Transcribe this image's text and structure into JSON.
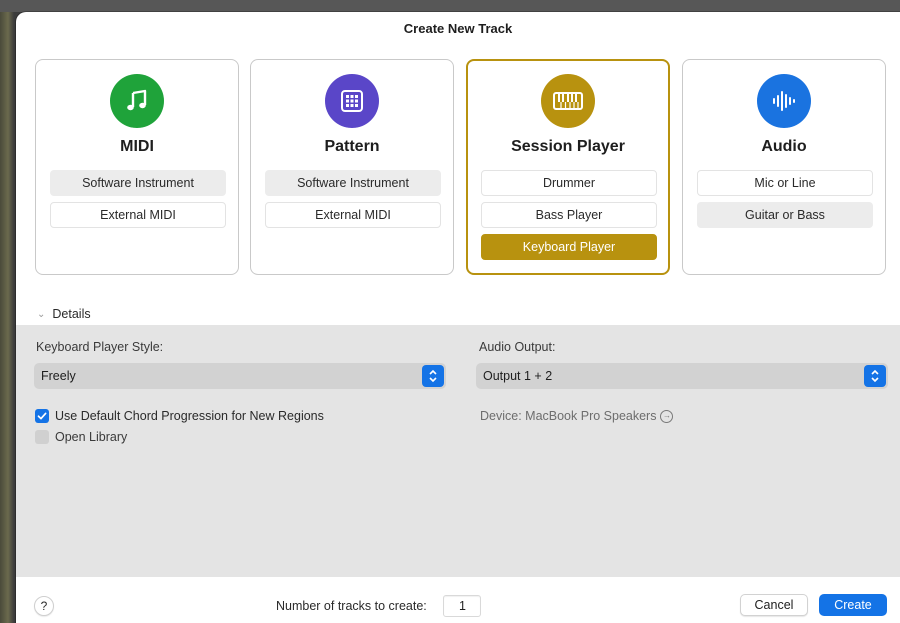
{
  "dialog": {
    "title": "Create New Track"
  },
  "cards": [
    {
      "title": "MIDI",
      "icon": "music-note-icon",
      "icon_color": "#1fa33a",
      "options": [
        {
          "label": "Software Instrument",
          "state": "highlighted"
        },
        {
          "label": "External MIDI",
          "state": "normal"
        }
      ]
    },
    {
      "title": "Pattern",
      "icon": "grid-pad-icon",
      "icon_color": "#5a46c8",
      "options": [
        {
          "label": "Software Instrument",
          "state": "highlighted"
        },
        {
          "label": "External MIDI",
          "state": "normal"
        }
      ]
    },
    {
      "title": "Session Player",
      "icon": "keyboard-icon",
      "icon_color": "#b8920f",
      "selected": true,
      "options": [
        {
          "label": "Drummer",
          "state": "normal"
        },
        {
          "label": "Bass Player",
          "state": "normal"
        },
        {
          "label": "Keyboard Player",
          "state": "selected"
        }
      ]
    },
    {
      "title": "Audio",
      "icon": "waveform-icon",
      "icon_color": "#1a73e0",
      "options": [
        {
          "label": "Mic or Line",
          "state": "normal"
        },
        {
          "label": "Guitar or Bass",
          "state": "highlighted"
        }
      ]
    }
  ],
  "details": {
    "toggle_label": "Details",
    "expanded": true,
    "style_label": "Keyboard Player Style:",
    "style_value": "Freely",
    "output_label": "Audio Output:",
    "output_value": "Output 1 + 2",
    "chord_checkbox_label": "Use Default Chord Progression for New Regions",
    "chord_checked": true,
    "library_checkbox_label": "Open Library",
    "library_checked": false,
    "device_text": "Device: MacBook Pro Speakers"
  },
  "footer": {
    "help_label": "?",
    "num_tracks_label": "Number of tracks to create:",
    "num_tracks_value": "1",
    "cancel_label": "Cancel",
    "create_label": "Create"
  },
  "colors": {
    "accent": "#1473e6",
    "session_gold": "#b8920f"
  }
}
